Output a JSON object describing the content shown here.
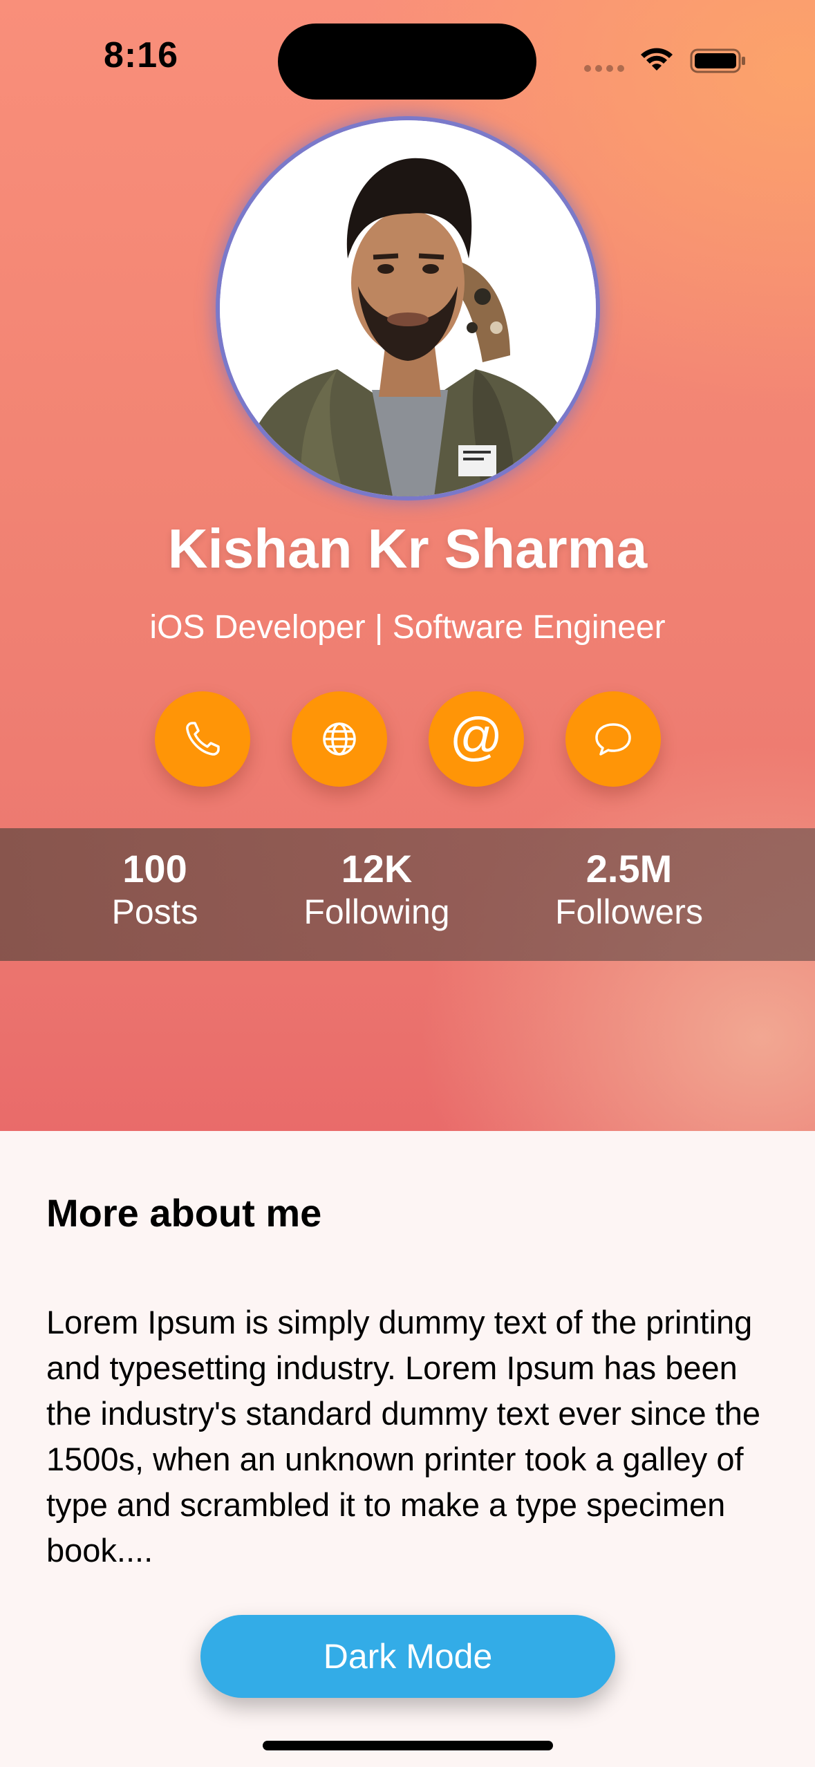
{
  "status_bar": {
    "time": "8:16",
    "wifi_icon": "wifi-icon",
    "battery_icon": "battery-icon"
  },
  "profile": {
    "avatar_icon": "profile-photo",
    "name": "Kishan Kr Sharma",
    "title": "iOS Developer | Software Engineer"
  },
  "actions": [
    {
      "icon": "phone-icon"
    },
    {
      "icon": "globe-icon"
    },
    {
      "icon": "at-sign-icon",
      "glyph": "@"
    },
    {
      "icon": "message-bubble-icon"
    }
  ],
  "stats": [
    {
      "value": "100",
      "label": "Posts"
    },
    {
      "value": "12K",
      "label": "Following"
    },
    {
      "value": "2.5M",
      "label": "Followers"
    }
  ],
  "about": {
    "heading": "More about me",
    "text": "Lorem Ipsum is simply dummy text of the printing and typesetting industry. Lorem Ipsum has been the industry's standard dummy text ever since the 1500s, when an unknown printer took a galley of type and scrambled it to make a type specimen book...."
  },
  "dark_mode_button": {
    "label": "Dark Mode"
  },
  "colors": {
    "action_orange": "#ff9507",
    "button_blue": "#33ace7",
    "hero_top": "#f98f7a",
    "hero_right": "#fca569"
  }
}
